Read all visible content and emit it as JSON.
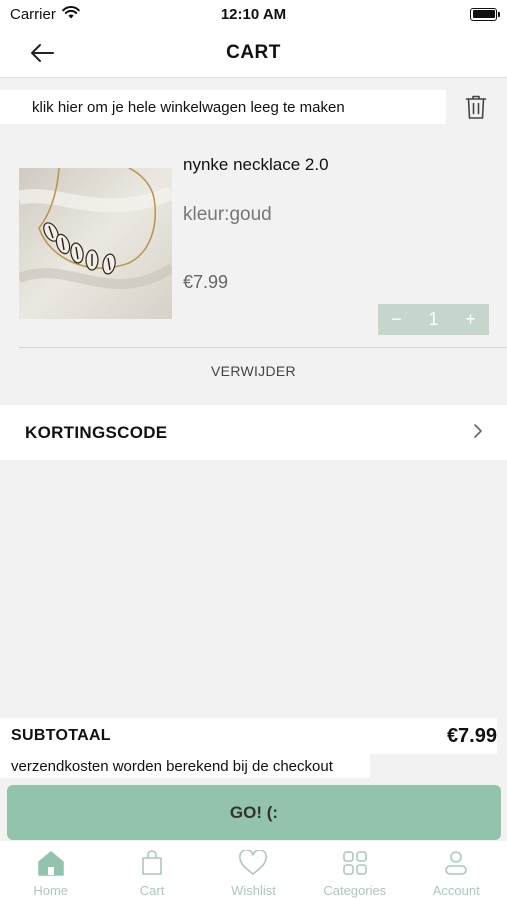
{
  "status_bar": {
    "carrier": "Carrier",
    "time": "12:10 AM"
  },
  "nav": {
    "title": "CART"
  },
  "clear_cart": {
    "text": "klik hier om je hele winkelwagen leeg te maken"
  },
  "cart_items": [
    {
      "name": "nynke necklace 2.0",
      "color": "kleur:goud",
      "price": "€7.99",
      "quantity": "1",
      "decrement": "−",
      "increment": "+",
      "remove_label": "VERWIJDER"
    }
  ],
  "discount": {
    "label": "KORTINGSCODE"
  },
  "summary": {
    "subtotal_label": "SUBTOTAAL",
    "subtotal_value": "€7.99",
    "shipping_note": "verzendkosten worden berekend bij de checkout"
  },
  "checkout": {
    "label": "GO! (:"
  },
  "tabs": [
    {
      "label": "Home",
      "icon": "home-icon"
    },
    {
      "label": "Cart",
      "icon": "bag-icon"
    },
    {
      "label": "Wishlist",
      "icon": "heart-icon"
    },
    {
      "label": "Categories",
      "icon": "grid-icon"
    },
    {
      "label": "Account",
      "icon": "user-icon"
    }
  ],
  "colors": {
    "accent": "#93c3ad",
    "tab_inactive": "#aac9bb",
    "stepper": "#c6d6cd",
    "background": "#f2f2f2"
  }
}
